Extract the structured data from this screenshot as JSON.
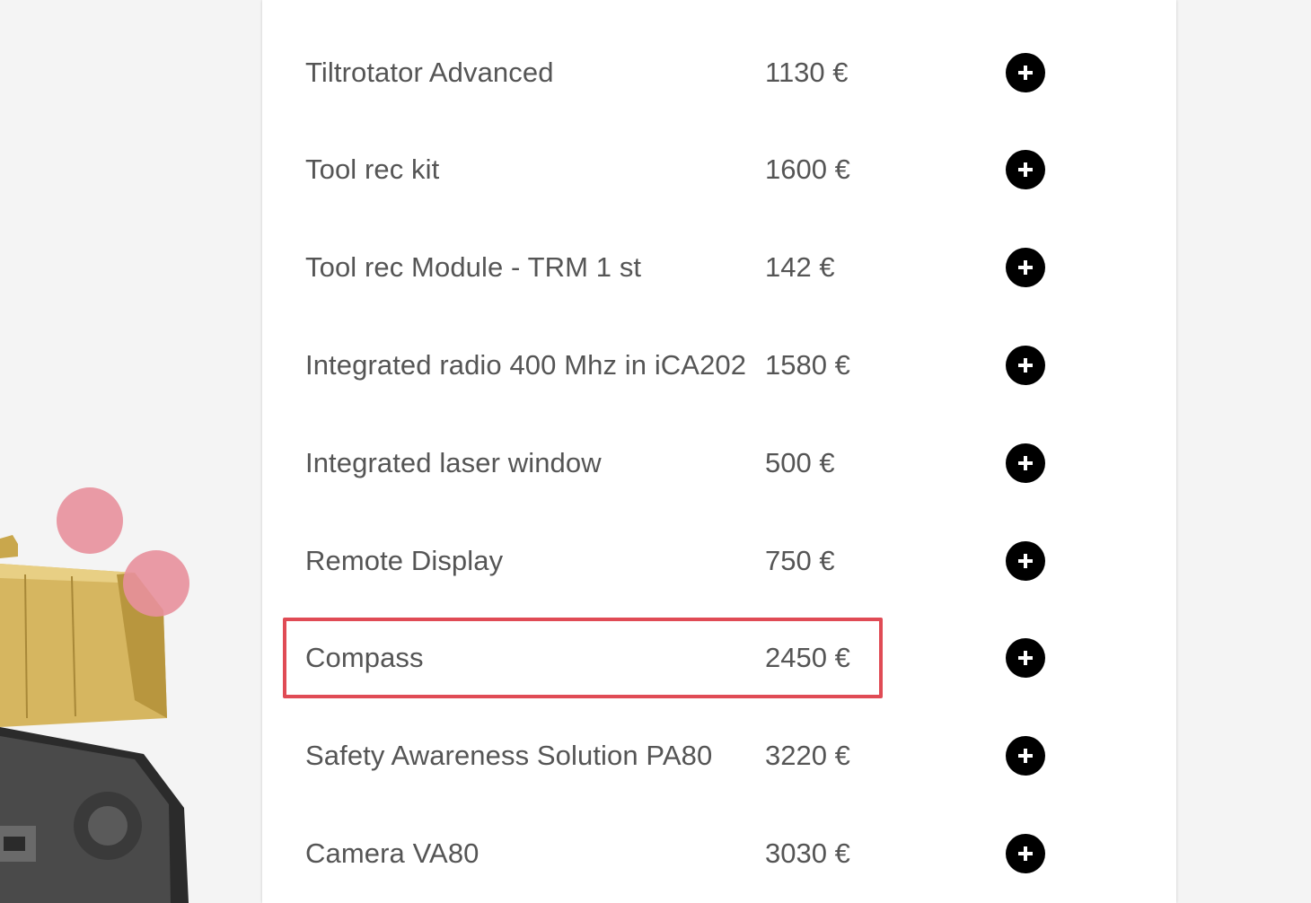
{
  "products": [
    {
      "name": "Tiltrotator Advanced",
      "price": "1130 €"
    },
    {
      "name": "Tool rec kit",
      "price": "1600 €"
    },
    {
      "name": "Tool rec Module - TRM 1 st",
      "price": "142 €"
    },
    {
      "name": "Integrated radio 400 Mhz in iCA202",
      "price": "1580 €"
    },
    {
      "name": "Integrated laser window",
      "price": "500 €"
    },
    {
      "name": "Remote Display",
      "price": "750 €"
    },
    {
      "name": "Compass",
      "price": "2450 €"
    },
    {
      "name": "Safety Awareness Solution PA80",
      "price": "3220 €"
    },
    {
      "name": "Camera VA80",
      "price": "3030 €"
    }
  ],
  "add_icon": "plus-circle-icon",
  "highlighted_product": "Compass",
  "colors": {
    "background": "#f4f4f4",
    "card": "#ffffff",
    "text": "#555555",
    "button": "#000000",
    "highlight": "#e04b55",
    "accent_dots": "#e8909c",
    "machine_body": "#d4b45a"
  }
}
